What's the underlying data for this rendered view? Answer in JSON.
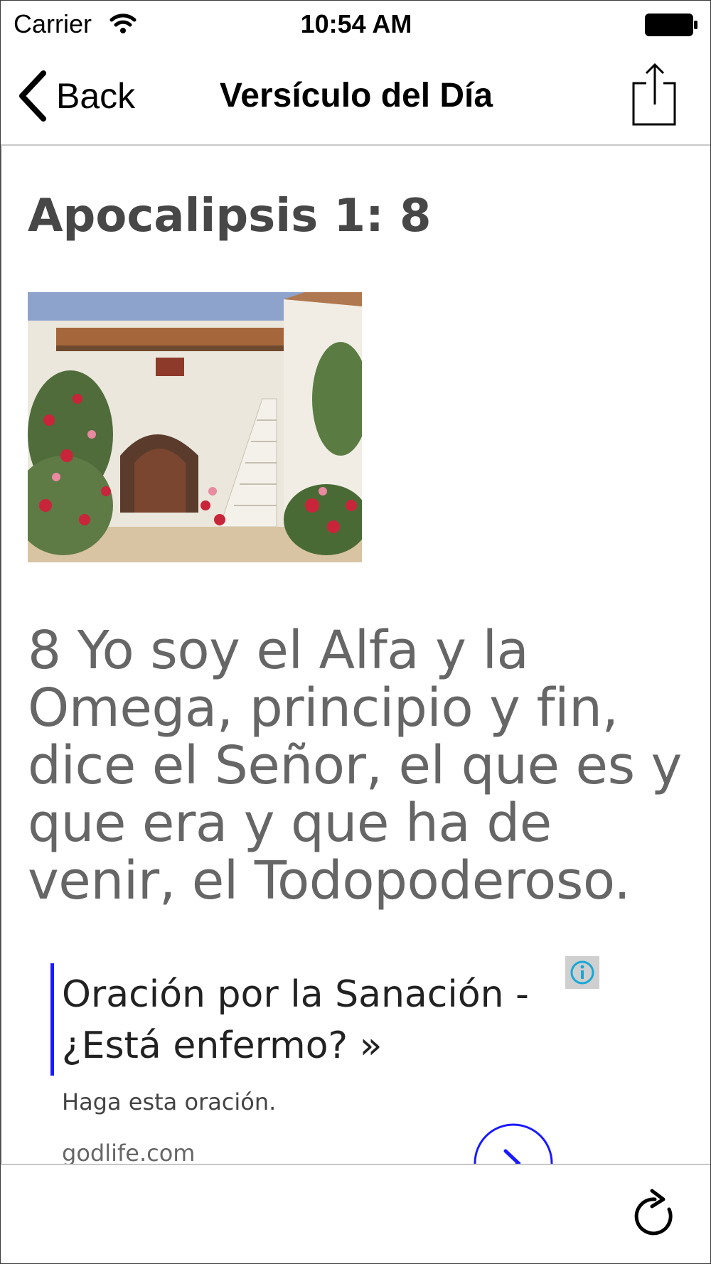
{
  "status_bar": {
    "carrier": "Carrier",
    "time": "10:54 AM",
    "icons": [
      "wifi-icon",
      "battery-icon"
    ]
  },
  "nav": {
    "back_label": "Back",
    "title": "Versículo del Día",
    "share_icon": "share-icon"
  },
  "verse": {
    "reference": "Apocalipsis 1: 8",
    "text": "8 Yo soy el Alfa y la Omega, principio y fin, dice el Señor, el que es y que era y que ha de venir, el Todopoderoso."
  },
  "ad": {
    "title": "Oración por la Sanación - ¿Está enfermo? »",
    "subtitle": "Haga esta oración.",
    "domain": "godlife.com",
    "accent_color": "#1a1aff"
  },
  "toolbar": {
    "refresh_icon": "refresh-icon"
  }
}
